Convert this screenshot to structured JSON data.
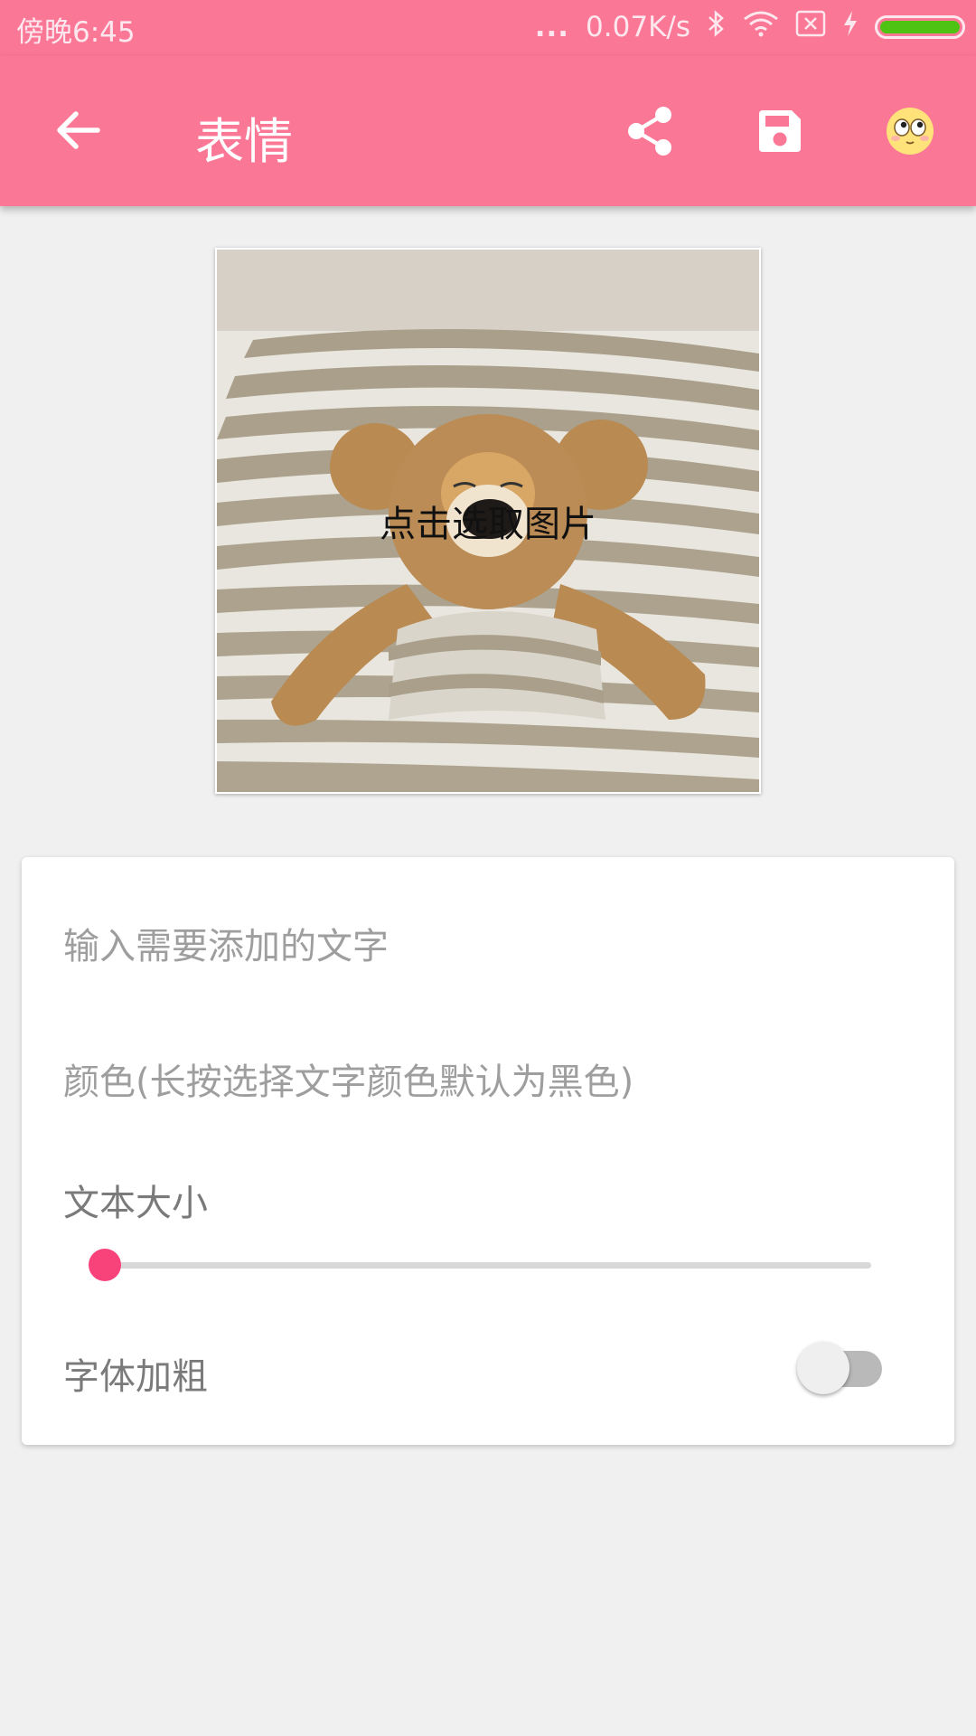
{
  "status_bar": {
    "time": "傍晚6:45",
    "dots": "...",
    "net_speed": "0.07K/s",
    "battery_color": "#4fc313"
  },
  "app_bar": {
    "title": "表情",
    "background": "#fb7796",
    "icons": [
      "arrow-back-icon",
      "share-icon",
      "save-icon",
      "emoji-face-icon"
    ]
  },
  "image_card": {
    "hint": "点击选取图片"
  },
  "form": {
    "text_placeholder": "输入需要添加的文字",
    "color_placeholder": "颜色(长按选择文字颜色默认为黑色)",
    "size_label": "文本大小",
    "size_value": 0,
    "bold_label": "字体加粗",
    "bold_on": false,
    "accent": "#f7437a"
  }
}
